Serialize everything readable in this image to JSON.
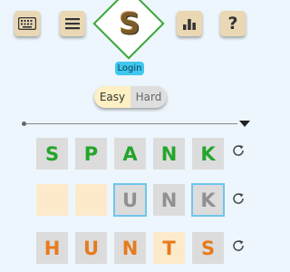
{
  "header": {
    "keyboard_icon": "keyboard-icon",
    "menu_icon": "hamburger-menu-icon",
    "logo_letter": "S",
    "stats_icon": "bar-chart-icon",
    "help_label": "?",
    "login_label": "Login"
  },
  "difficulty": {
    "options": [
      "Easy",
      "Hard"
    ],
    "selected": "Easy"
  },
  "board": {
    "rows": [
      {
        "tiles": [
          {
            "letter": "S",
            "state": "correct"
          },
          {
            "letter": "P",
            "state": "correct"
          },
          {
            "letter": "A",
            "state": "correct"
          },
          {
            "letter": "N",
            "state": "correct"
          },
          {
            "letter": "K",
            "state": "correct"
          }
        ]
      },
      {
        "tiles": [
          {
            "letter": "",
            "state": "empty"
          },
          {
            "letter": "",
            "state": "empty"
          },
          {
            "letter": "U",
            "state": "absent",
            "highlighted": true
          },
          {
            "letter": "N",
            "state": "absent"
          },
          {
            "letter": "K",
            "state": "absent",
            "highlighted": true
          }
        ]
      },
      {
        "tiles": [
          {
            "letter": "H",
            "state": "present"
          },
          {
            "letter": "U",
            "state": "present"
          },
          {
            "letter": "N",
            "state": "present"
          },
          {
            "letter": "T",
            "state": "present-cream"
          },
          {
            "letter": "S",
            "state": "present"
          }
        ]
      }
    ]
  },
  "colors": {
    "correct": "#24a52b",
    "present": "#e67b1e",
    "absent": "#909090",
    "accent": "#3fc7ef"
  }
}
